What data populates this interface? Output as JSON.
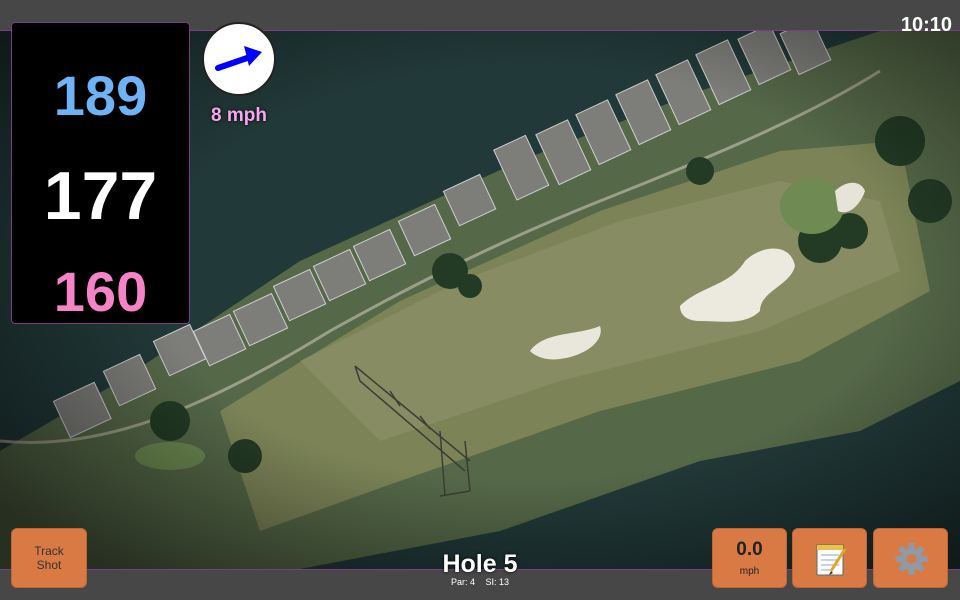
{
  "status": {
    "time": "10:10"
  },
  "distances": {
    "back": "189",
    "center": "177",
    "front": "160"
  },
  "wind": {
    "speed_label": "8 mph",
    "direction_icon": "arrow-right-icon",
    "arrow_color": "#0000ff"
  },
  "hole": {
    "title": "Hole 5",
    "par_label": "Par: 4",
    "si_label": "SI: 13"
  },
  "buttons": {
    "track_shot_line1": "Track",
    "track_shot_line2": "Shot",
    "speed_value": "0.0",
    "speed_unit": "mph",
    "notes_icon": "notepad-icon",
    "settings_icon": "gear-icon"
  },
  "colors": {
    "back_distance": "#6fb3f7",
    "center_distance": "#ffffff",
    "front_distance": "#f583c6",
    "wind_text": "#f7a6f0",
    "button_bg": "#d97a45",
    "frame_border": "#7a3d86"
  }
}
